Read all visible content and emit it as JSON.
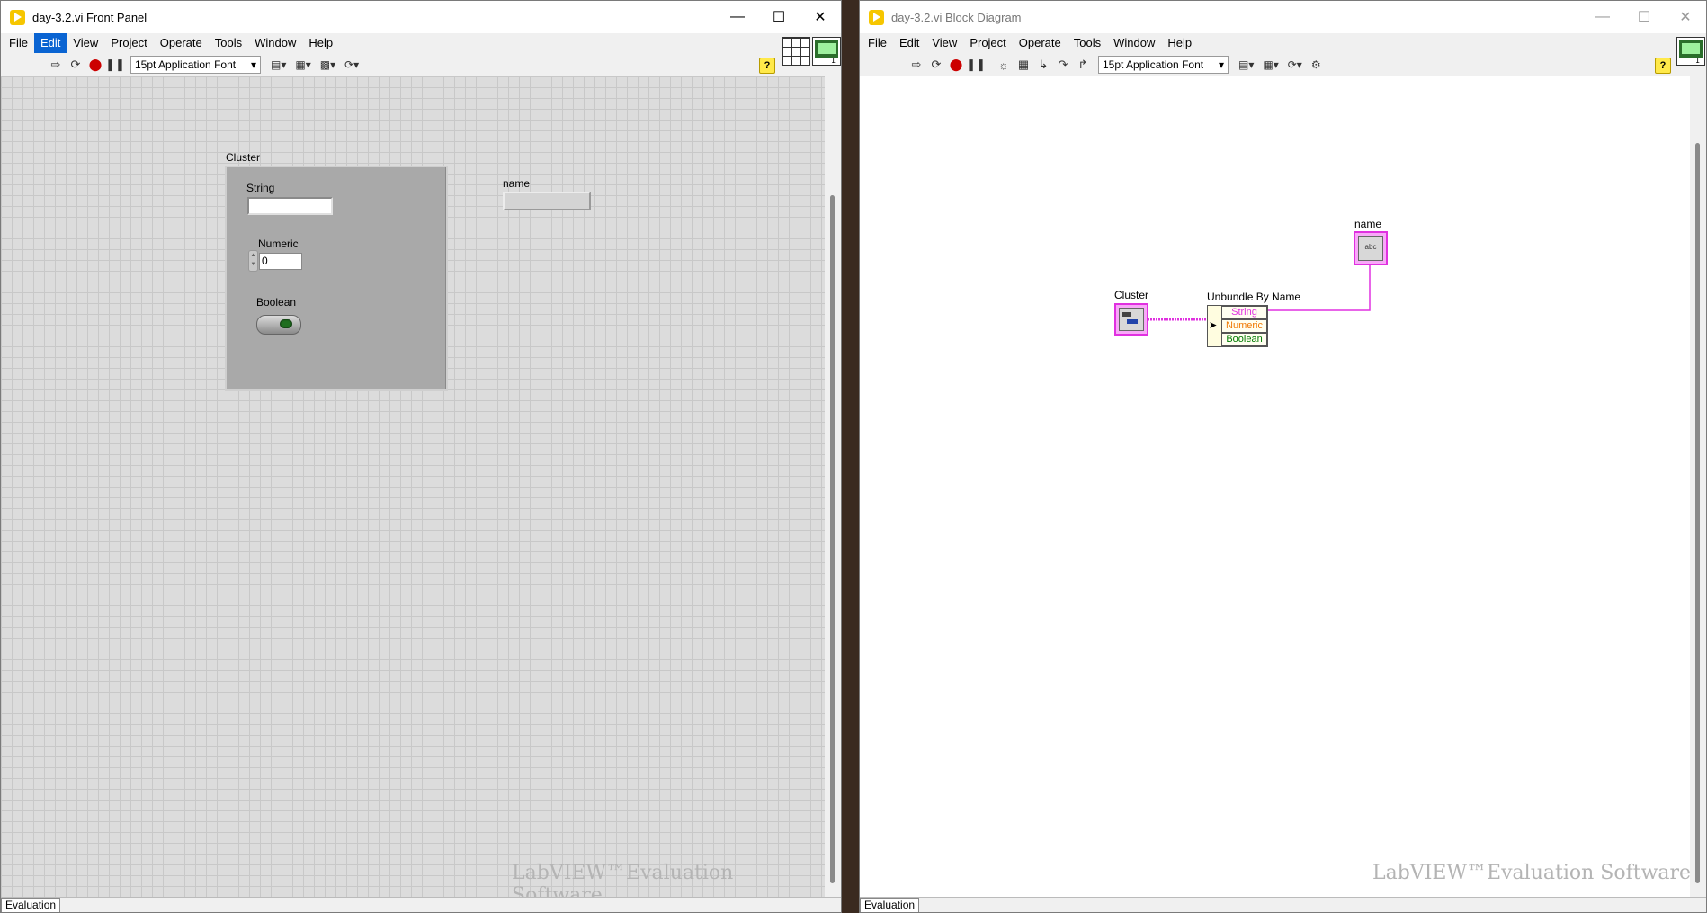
{
  "front_panel": {
    "title": "day-3.2.vi Front Panel",
    "menu": [
      "File",
      "Edit",
      "View",
      "Project",
      "Operate",
      "Tools",
      "Window",
      "Help"
    ],
    "active_menu": "Edit",
    "font_select": "15pt Application Font",
    "cluster": {
      "label": "Cluster",
      "string_label": "String",
      "string_value": "",
      "numeric_label": "Numeric",
      "numeric_value": "0",
      "boolean_label": "Boolean"
    },
    "name_indicator": {
      "label": "name",
      "value": ""
    },
    "watermark": "LabVIEW™Evaluation Software",
    "status_tab": "Evaluation"
  },
  "block_diagram": {
    "title": "day-3.2.vi Block Diagram",
    "menu": [
      "File",
      "Edit",
      "View",
      "Project",
      "Operate",
      "Tools",
      "Window",
      "Help"
    ],
    "font_select": "15pt Application Font",
    "cluster_terminal_label": "Cluster",
    "unbundle": {
      "label": "Unbundle By Name",
      "elements": [
        "String",
        "Numeric",
        "Boolean"
      ]
    },
    "name_terminal_label": "name",
    "name_terminal_text": "abc",
    "watermark": "LabVIEW™Evaluation Software",
    "status_tab": "Evaluation"
  },
  "colors": {
    "string_wire": "#e030e0",
    "numeric_text": "#f07800",
    "boolean_text": "#007a00"
  },
  "icons": [
    "run-arrow-icon",
    "run-continuously-icon",
    "abort-icon",
    "pause-icon",
    "highlight-execution-icon",
    "retain-wire-values-icon",
    "step-into-icon",
    "step-over-icon",
    "step-out-icon",
    "align-icon",
    "distribute-icon",
    "resize-icon",
    "reorder-icon",
    "cleanup-icon",
    "help-icon"
  ]
}
